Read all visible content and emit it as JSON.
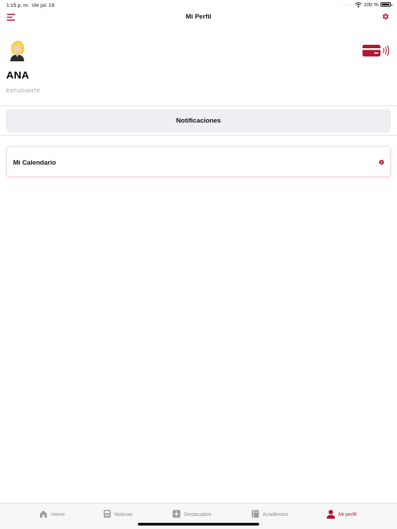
{
  "status_bar": {
    "time": "1:15 p. m.",
    "date": "Vie jul. 19",
    "dots": "....",
    "battery": "100 %"
  },
  "nav": {
    "title": "Mi Perfil",
    "menu_icon": "hamburger-menu-icon",
    "settings_icon": "gear-icon"
  },
  "profile": {
    "name": "ANA",
    "role": "ESTUDIANTE",
    "avatar_icon": "avatar-woman-icon",
    "card_icon": "contactless-card-icon"
  },
  "buttons": {
    "notifications": "Notificaciones"
  },
  "list": {
    "items": [
      {
        "label": "Mi Calendario",
        "icon": "chevron-right-circle-icon"
      }
    ]
  },
  "tab_bar": {
    "tabs": [
      {
        "label": "Home",
        "icon": "home-icon"
      },
      {
        "label": "Noticias",
        "icon": "news-icon"
      },
      {
        "label": "Destacados",
        "icon": "plus-square-icon"
      },
      {
        "label": "Académico",
        "icon": "book-icon"
      },
      {
        "label": "Mi perfil",
        "icon": "person-icon",
        "active": true
      }
    ]
  },
  "colors": {
    "accent": "#b3172f",
    "inactive_tab": "#8a8a8a",
    "button_bg": "#efeff3"
  }
}
